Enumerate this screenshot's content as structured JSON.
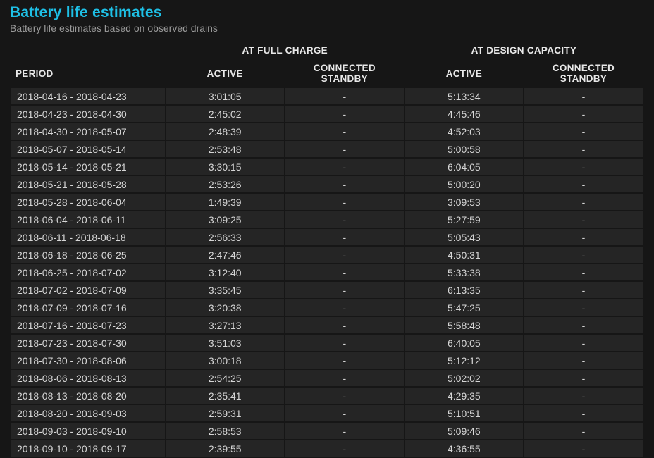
{
  "header": {
    "title": "Battery life estimates",
    "subtitle": "Battery life estimates based on observed drains"
  },
  "columns": {
    "period": "PERIOD",
    "group_full": "AT FULL CHARGE",
    "group_design": "AT DESIGN CAPACITY",
    "active": "ACTIVE",
    "standby": "CONNECTED STANDBY"
  },
  "rows": [
    {
      "period": "2018-04-16 - 2018-04-23",
      "full_active": "3:01:05",
      "full_standby": "-",
      "design_active": "5:13:34",
      "design_standby": "-"
    },
    {
      "period": "2018-04-23 - 2018-04-30",
      "full_active": "2:45:02",
      "full_standby": "-",
      "design_active": "4:45:46",
      "design_standby": "-"
    },
    {
      "period": "2018-04-30 - 2018-05-07",
      "full_active": "2:48:39",
      "full_standby": "-",
      "design_active": "4:52:03",
      "design_standby": "-"
    },
    {
      "period": "2018-05-07 - 2018-05-14",
      "full_active": "2:53:48",
      "full_standby": "-",
      "design_active": "5:00:58",
      "design_standby": "-"
    },
    {
      "period": "2018-05-14 - 2018-05-21",
      "full_active": "3:30:15",
      "full_standby": "-",
      "design_active": "6:04:05",
      "design_standby": "-"
    },
    {
      "period": "2018-05-21 - 2018-05-28",
      "full_active": "2:53:26",
      "full_standby": "-",
      "design_active": "5:00:20",
      "design_standby": "-"
    },
    {
      "period": "2018-05-28 - 2018-06-04",
      "full_active": "1:49:39",
      "full_standby": "-",
      "design_active": "3:09:53",
      "design_standby": "-"
    },
    {
      "period": "2018-06-04 - 2018-06-11",
      "full_active": "3:09:25",
      "full_standby": "-",
      "design_active": "5:27:59",
      "design_standby": "-"
    },
    {
      "period": "2018-06-11 - 2018-06-18",
      "full_active": "2:56:33",
      "full_standby": "-",
      "design_active": "5:05:43",
      "design_standby": "-"
    },
    {
      "period": "2018-06-18 - 2018-06-25",
      "full_active": "2:47:46",
      "full_standby": "-",
      "design_active": "4:50:31",
      "design_standby": "-"
    },
    {
      "period": "2018-06-25 - 2018-07-02",
      "full_active": "3:12:40",
      "full_standby": "-",
      "design_active": "5:33:38",
      "design_standby": "-"
    },
    {
      "period": "2018-07-02 - 2018-07-09",
      "full_active": "3:35:45",
      "full_standby": "-",
      "design_active": "6:13:35",
      "design_standby": "-"
    },
    {
      "period": "2018-07-09 - 2018-07-16",
      "full_active": "3:20:38",
      "full_standby": "-",
      "design_active": "5:47:25",
      "design_standby": "-"
    },
    {
      "period": "2018-07-16 - 2018-07-23",
      "full_active": "3:27:13",
      "full_standby": "-",
      "design_active": "5:58:48",
      "design_standby": "-"
    },
    {
      "period": "2018-07-23 - 2018-07-30",
      "full_active": "3:51:03",
      "full_standby": "-",
      "design_active": "6:40:05",
      "design_standby": "-"
    },
    {
      "period": "2018-07-30 - 2018-08-06",
      "full_active": "3:00:18",
      "full_standby": "-",
      "design_active": "5:12:12",
      "design_standby": "-"
    },
    {
      "period": "2018-08-06 - 2018-08-13",
      "full_active": "2:54:25",
      "full_standby": "-",
      "design_active": "5:02:02",
      "design_standby": "-"
    },
    {
      "period": "2018-08-13 - 2018-08-20",
      "full_active": "2:35:41",
      "full_standby": "-",
      "design_active": "4:29:35",
      "design_standby": "-"
    },
    {
      "period": "2018-08-20 - 2018-09-03",
      "full_active": "2:59:31",
      "full_standby": "-",
      "design_active": "5:10:51",
      "design_standby": "-"
    },
    {
      "period": "2018-09-03 - 2018-09-10",
      "full_active": "2:58:53",
      "full_standby": "-",
      "design_active": "5:09:46",
      "design_standby": "-"
    },
    {
      "period": "2018-09-10 - 2018-09-17",
      "full_active": "2:39:55",
      "full_standby": "-",
      "design_active": "4:36:55",
      "design_standby": "-"
    }
  ]
}
